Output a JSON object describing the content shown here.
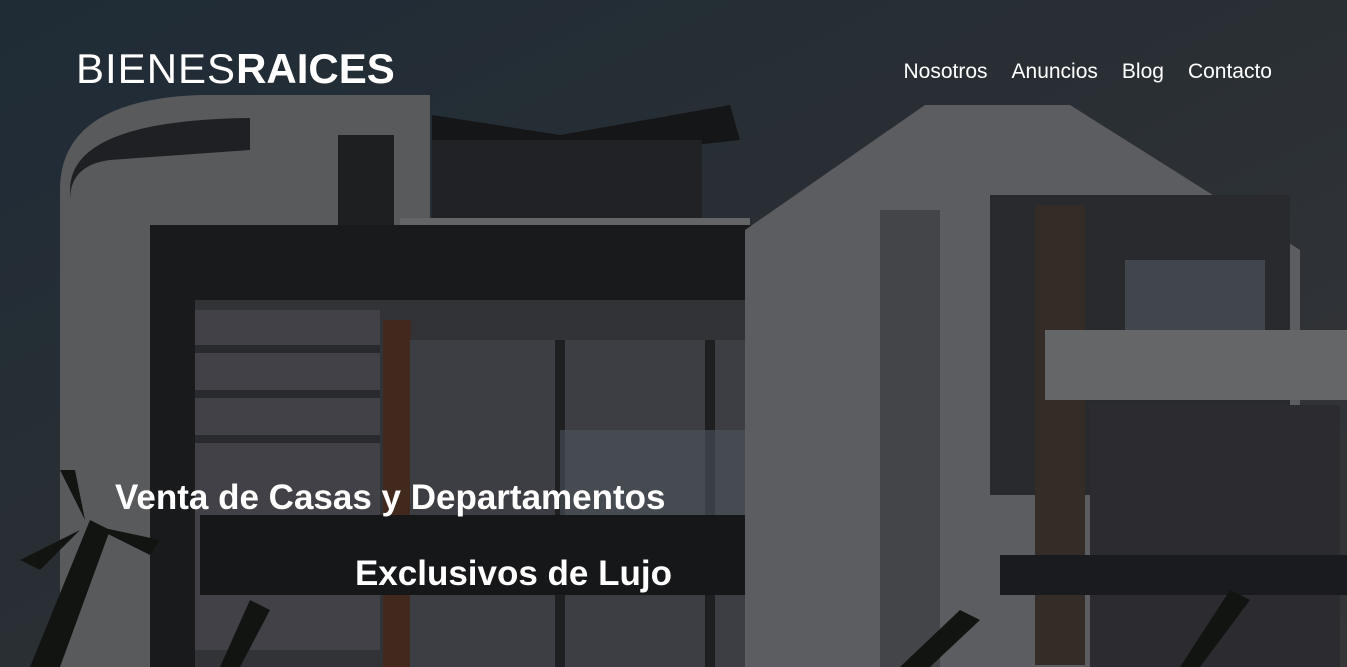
{
  "header": {
    "logo_light": "BIENES",
    "logo_bold": "RAICES"
  },
  "nav": {
    "items": [
      {
        "label": "Nosotros"
      },
      {
        "label": "Anuncios"
      },
      {
        "label": "Blog"
      },
      {
        "label": "Contacto"
      }
    ]
  },
  "hero": {
    "headline_line1": "Venta de Casas y Departamentos",
    "headline_line2": "Exclusivos de Lujo"
  },
  "colors": {
    "text": "#ffffff",
    "sky": "#2e3d4a"
  }
}
